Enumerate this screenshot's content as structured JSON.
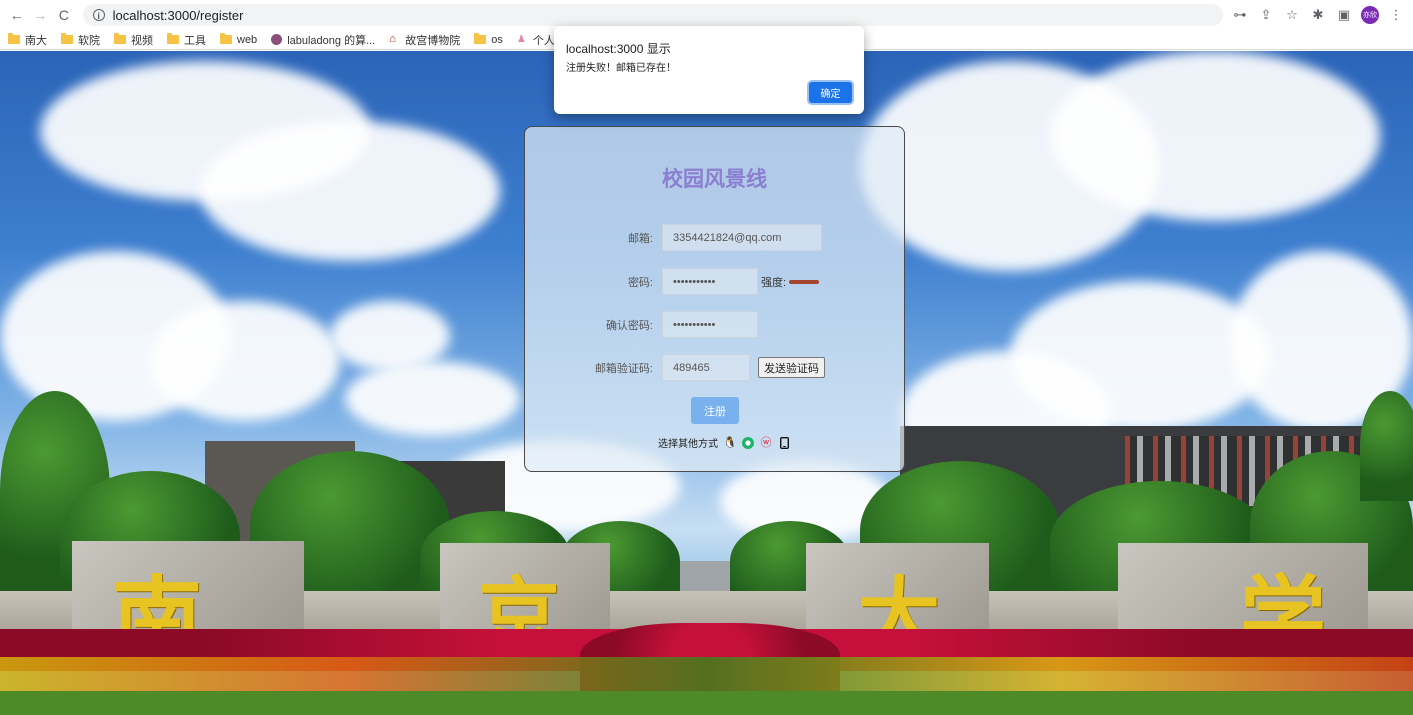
{
  "browser": {
    "url": "localhost:3000/register",
    "bookmarks": [
      {
        "label": "南大",
        "icon": "folder-icon"
      },
      {
        "label": "软院",
        "icon": "folder-icon"
      },
      {
        "label": "视频",
        "icon": "folder-icon"
      },
      {
        "label": "工具",
        "icon": "folder-icon"
      },
      {
        "label": "web",
        "icon": "folder-icon"
      },
      {
        "label": "labuladong 的算...",
        "icon": "site-icon"
      },
      {
        "label": "故宫博物院",
        "icon": "museum-icon"
      },
      {
        "label": "os",
        "icon": "folder-icon"
      },
      {
        "label": "个人主页",
        "icon": "homepage-icon"
      }
    ],
    "avatar_text": "亦欣"
  },
  "alert": {
    "title": "localhost:3000 显示",
    "message": "注册失败！邮箱已存在！",
    "ok_label": "确定"
  },
  "form": {
    "title": "校园风景线",
    "email_label": "邮箱:",
    "email_value": "3354421824@qq.com",
    "password_label": "密码:",
    "password_value": "•••••••••••",
    "strength_label": "强度:",
    "confirm_label": "确认密码:",
    "confirm_value": "•••••••••••",
    "code_label": "邮箱验证码:",
    "code_value": "489465",
    "send_code_label": "发送验证码",
    "submit_label": "注册",
    "other_methods_label": "选择其他方式"
  },
  "colors": {
    "title": "#8a7fd0",
    "submit": "#79b0ee",
    "strength": "#a4452f",
    "alert_ok": "#1a73e8"
  },
  "background": {
    "stone_characters": [
      "南",
      "京",
      "大",
      "学"
    ]
  }
}
